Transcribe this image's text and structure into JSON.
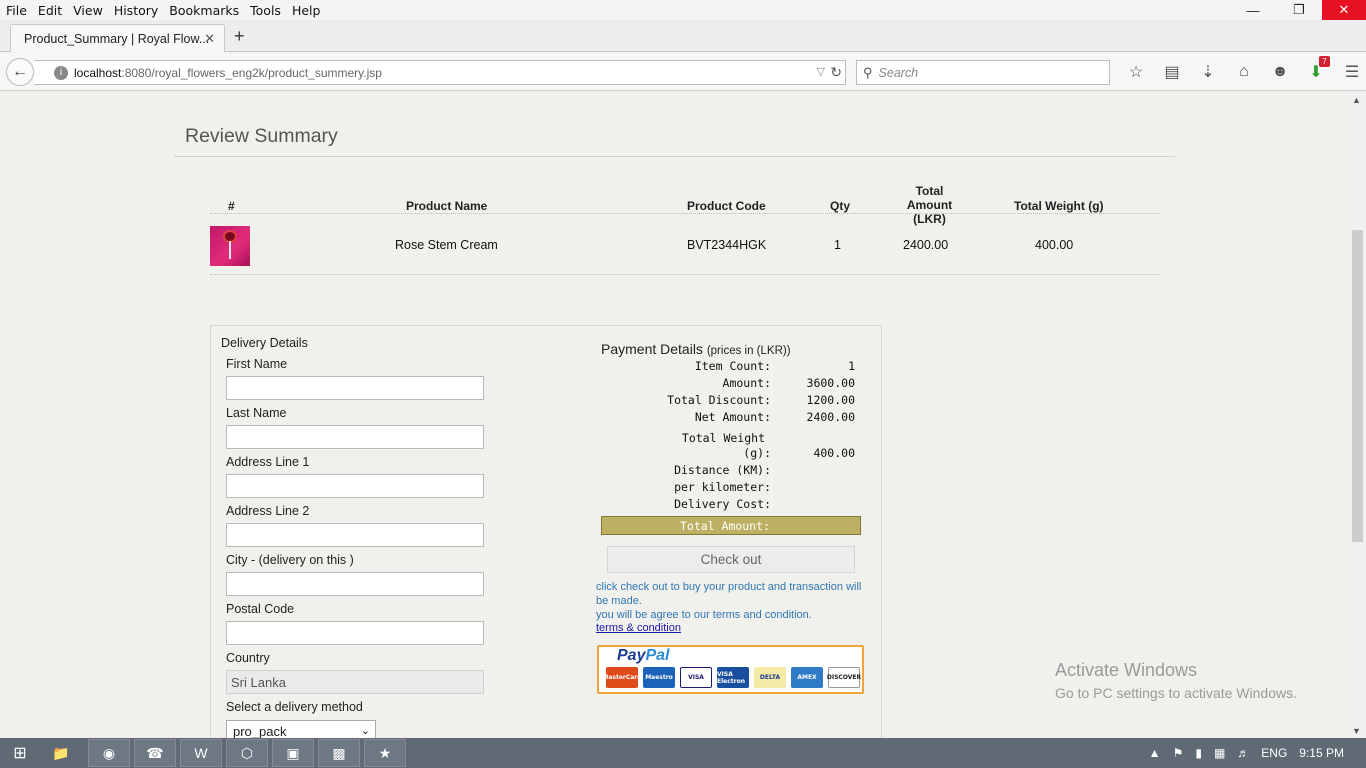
{
  "browser": {
    "menu": [
      "File",
      "Edit",
      "View",
      "History",
      "Bookmarks",
      "Tools",
      "Help"
    ],
    "tab_title": "Product_Summary | Royal Flow...",
    "url_host": "localhost",
    "url_path": ":8080/royal_flowers_eng2k/product_summery.jsp",
    "search_placeholder": "Search",
    "download_badge": "7"
  },
  "page": {
    "title": "Review Summary",
    "table": {
      "headers": {
        "num": "#",
        "name": "Product Name",
        "code": "Product Code",
        "qty": "Qty",
        "amount_1": "Total Amount",
        "amount_2": "(LKR)",
        "weight": "Total Weight (g)"
      },
      "rows": [
        {
          "name": "Rose Stem Cream",
          "code": "BVT2344HGK",
          "qty": "1",
          "amount": "2400.00",
          "weight": "400.00"
        }
      ]
    },
    "delivery": {
      "title": "Delivery Details",
      "first_name": "First Name",
      "last_name": "Last Name",
      "address1": "Address Line 1",
      "address2": "Address Line 2",
      "city": "City - (delivery on this )",
      "postal": "Postal Code",
      "country_label": "Country",
      "country_value": "Sri Lanka",
      "method_label": "Select a delivery method",
      "method_value": "pro_pack"
    },
    "payment": {
      "title": "Payment Details",
      "subtitle": "(prices in (LKR))",
      "item_count_label": "Item Count:",
      "item_count": "1",
      "amount_label": "Amount:",
      "amount": "3600.00",
      "discount_label": "Total Discount:",
      "discount": "1200.00",
      "net_label": "Net Amount:",
      "net": "2400.00",
      "weight_label_1": "Total Weight",
      "weight_label_2": "(g):",
      "weight": "400.00",
      "distance_label": "Distance (KM):",
      "perkm_label": "per kilometer:",
      "delivery_cost_label": "Delivery Cost:",
      "total_label": "Total Amount:",
      "checkout": "Check out",
      "note_1": "click check out to buy your product and transaction will be made.",
      "note_2": "you will be agree to our terms and condition.",
      "terms": "terms & condition",
      "paypal_1": "Pay",
      "paypal_2": "Pal",
      "cards": [
        "MasterCard",
        "Maestro",
        "VISA",
        "VISA Electron",
        "DELTA",
        "AMEX",
        "DISCOVER"
      ]
    }
  },
  "watermark": {
    "line1": "Activate Windows",
    "line2": "Go to PC settings to activate Windows."
  },
  "taskbar": {
    "lang": "ENG",
    "time": "9:15 PM"
  }
}
